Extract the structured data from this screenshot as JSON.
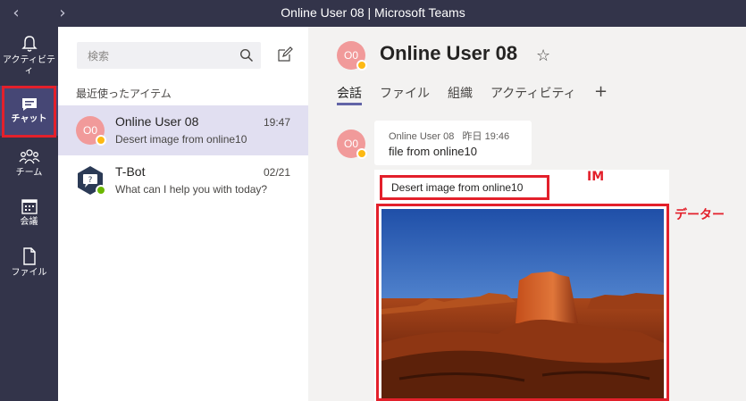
{
  "window": {
    "title": "Online User 08 | Microsoft Teams"
  },
  "rail": {
    "items": [
      {
        "label": "アクティビティ",
        "icon": "bell-icon"
      },
      {
        "label": "チャット",
        "icon": "chat-icon"
      },
      {
        "label": "チーム",
        "icon": "teams-icon"
      },
      {
        "label": "会議",
        "icon": "calendar-icon"
      },
      {
        "label": "ファイル",
        "icon": "file-icon"
      }
    ]
  },
  "list": {
    "search_placeholder": "検索",
    "section_title": "最近使ったアイテム",
    "chats": [
      {
        "initials": "O0",
        "name": "Online User 08",
        "time": "19:47",
        "preview": "Desert image from online10",
        "status": "away"
      },
      {
        "initials": "",
        "name": "T-Bot",
        "time": "02/21",
        "preview": "What can I help you with today?",
        "status": "available"
      }
    ]
  },
  "main": {
    "header": {
      "initials": "O0",
      "name": "Online User 08"
    },
    "tabs": [
      {
        "label": "会話"
      },
      {
        "label": "ファイル"
      },
      {
        "label": "組織"
      },
      {
        "label": "アクティビティ"
      }
    ],
    "messages": [
      {
        "author": "Online User 08",
        "timestamp": "昨日 19:46",
        "text": "file from online10"
      }
    ],
    "attachment": {
      "caption": "Desert image from online10"
    }
  },
  "annotations": {
    "im": "IM",
    "data": "データー"
  },
  "colors": {
    "rail": "#33344a",
    "accent": "#6264a7",
    "highlight": "#e3202b",
    "avatar": "#f19a9a"
  }
}
